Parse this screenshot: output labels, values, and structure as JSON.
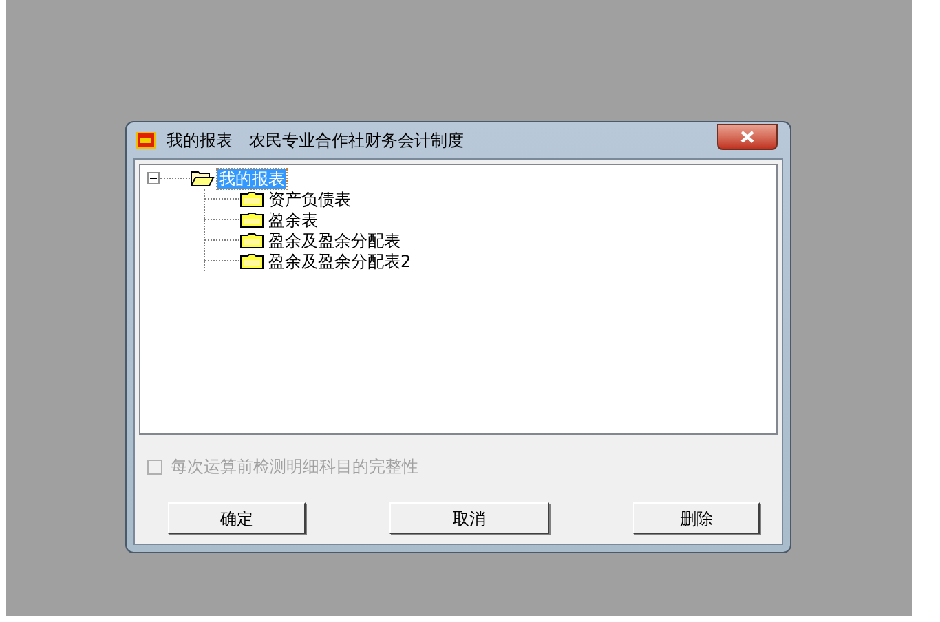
{
  "window": {
    "title": "我的报表　农民专业合作社财务会计制度"
  },
  "tree": [
    {
      "label": "我的报表",
      "expanded": true,
      "selected": true,
      "children": [
        {
          "label": "资产负债表",
          "selected": false
        },
        {
          "label": "盈余表",
          "selected": false
        },
        {
          "label": "盈余及盈余分配表",
          "selected": false
        },
        {
          "label": "盈余及盈余分配表2",
          "selected": false
        }
      ]
    }
  ],
  "checkbox": {
    "label": "每次运算前检测明细科目的完整性",
    "checked": false,
    "disabled": true
  },
  "buttons": [
    "确定",
    "取消",
    "删除"
  ]
}
